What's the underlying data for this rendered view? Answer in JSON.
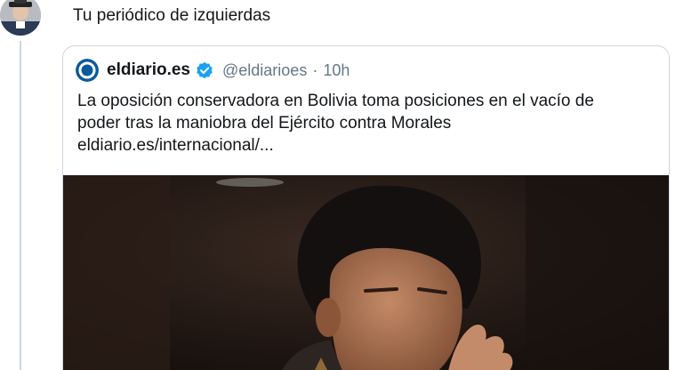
{
  "tweet": {
    "text": "Tu periódico de izquierdas",
    "avatar_icon": "user-avatar"
  },
  "quote": {
    "name": "eldiario.es",
    "verified_icon": "verified-badge-icon",
    "handle": "@eldiarioes",
    "separator": "·",
    "time": "10h",
    "text_line1": "La oposición conservadora en Bolivia toma posiciones en el vacío de",
    "text_line2": "poder tras la maniobra del Ejército contra Morales",
    "link": "eldiario.es/internacional/...",
    "image_icon": "news-photo"
  },
  "colors": {
    "brand_blue": "#0a5a9c",
    "verified_blue": "#1da1f2",
    "secondary_text": "#657786",
    "border": "#ccd6dd"
  }
}
